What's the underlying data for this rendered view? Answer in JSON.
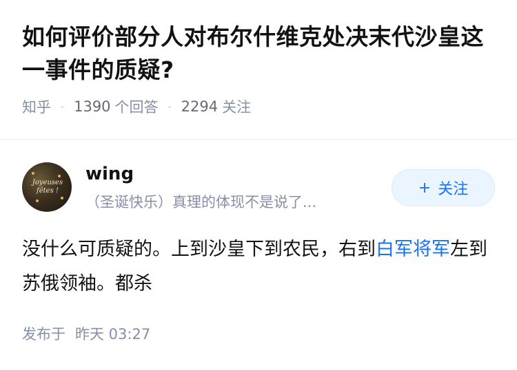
{
  "question": {
    "title": "如何评价部分人对布尔什维克处决末代沙皇这一事件的质疑?",
    "source": "知乎",
    "answers_count": "1390",
    "answers_label": "个回答",
    "followers_count": "2294",
    "followers_label": "关注"
  },
  "answer": {
    "author": {
      "name": "wing",
      "bio": "（圣诞快乐）真理的体现不是说了...",
      "avatar_text": "Joyeuses fêtes !",
      "follow_label": "关注",
      "follow_icon": "plus-icon"
    },
    "content": {
      "part1": "没什么可质疑的。上到沙皇下到农民，右到",
      "link_text": "白军将军",
      "part2": "左到苏俄领袖。都杀"
    },
    "time_label": "发布于",
    "time_value": "昨天 03:27"
  },
  "colors": {
    "link": "#1772f6",
    "meta": "#8590a6",
    "follow_bg": "#ebf5ff"
  }
}
